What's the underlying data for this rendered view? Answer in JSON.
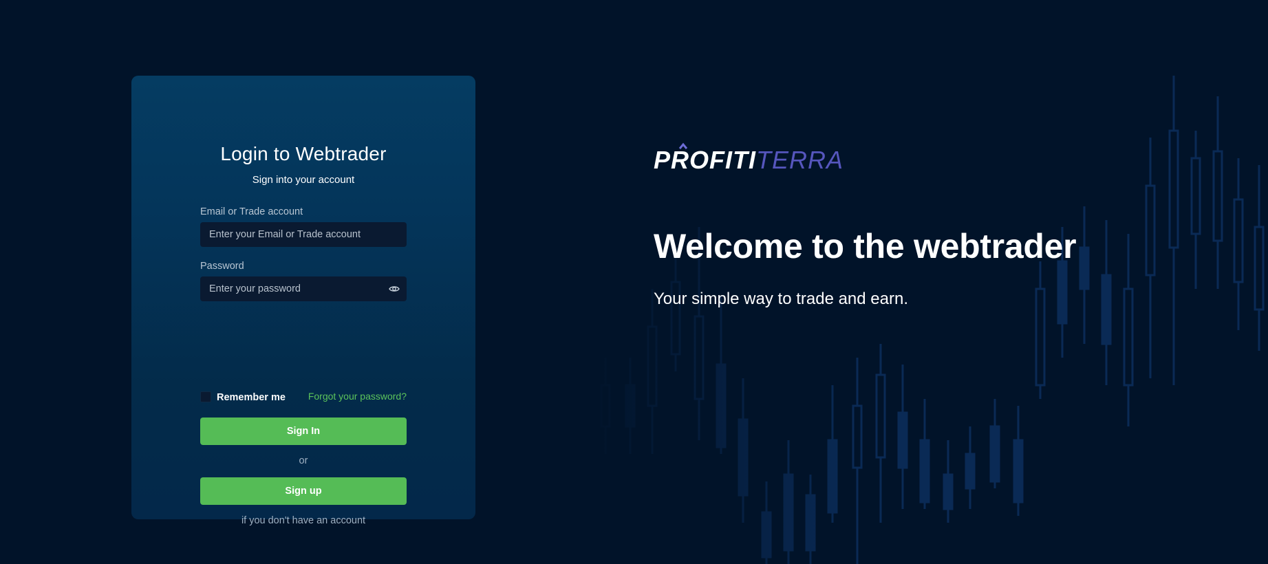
{
  "login": {
    "title": "Login to Webtrader",
    "subtitle": "Sign into your account",
    "email_label": "Email or Trade account",
    "email_placeholder": "Enter your Email or Trade account",
    "password_label": "Password",
    "password_placeholder": "Enter your password",
    "remember_label": "Remember me",
    "remember_checked": false,
    "forgot_label": "Forgot your password?",
    "signin_label": "Sign In",
    "or_label": "or",
    "signup_label": "Sign up",
    "no_account_label": "if you don't have an account"
  },
  "brand": {
    "logo_part1": "PROFITI",
    "logo_part2": "TERRA",
    "welcome_title": "Welcome to the webtrader",
    "welcome_subtitle": "Your simple way to trade and earn."
  },
  "colors": {
    "background": "#011329",
    "card": "#053c62",
    "accent_green": "#55bc56",
    "link_green": "#5cc45b",
    "logo_purple": "#5656bd"
  },
  "icons": {
    "password_toggle": "eye-icon",
    "logo_mark": "arrow-up-chevron-icon",
    "background": "candlestick-chart-decoration"
  }
}
